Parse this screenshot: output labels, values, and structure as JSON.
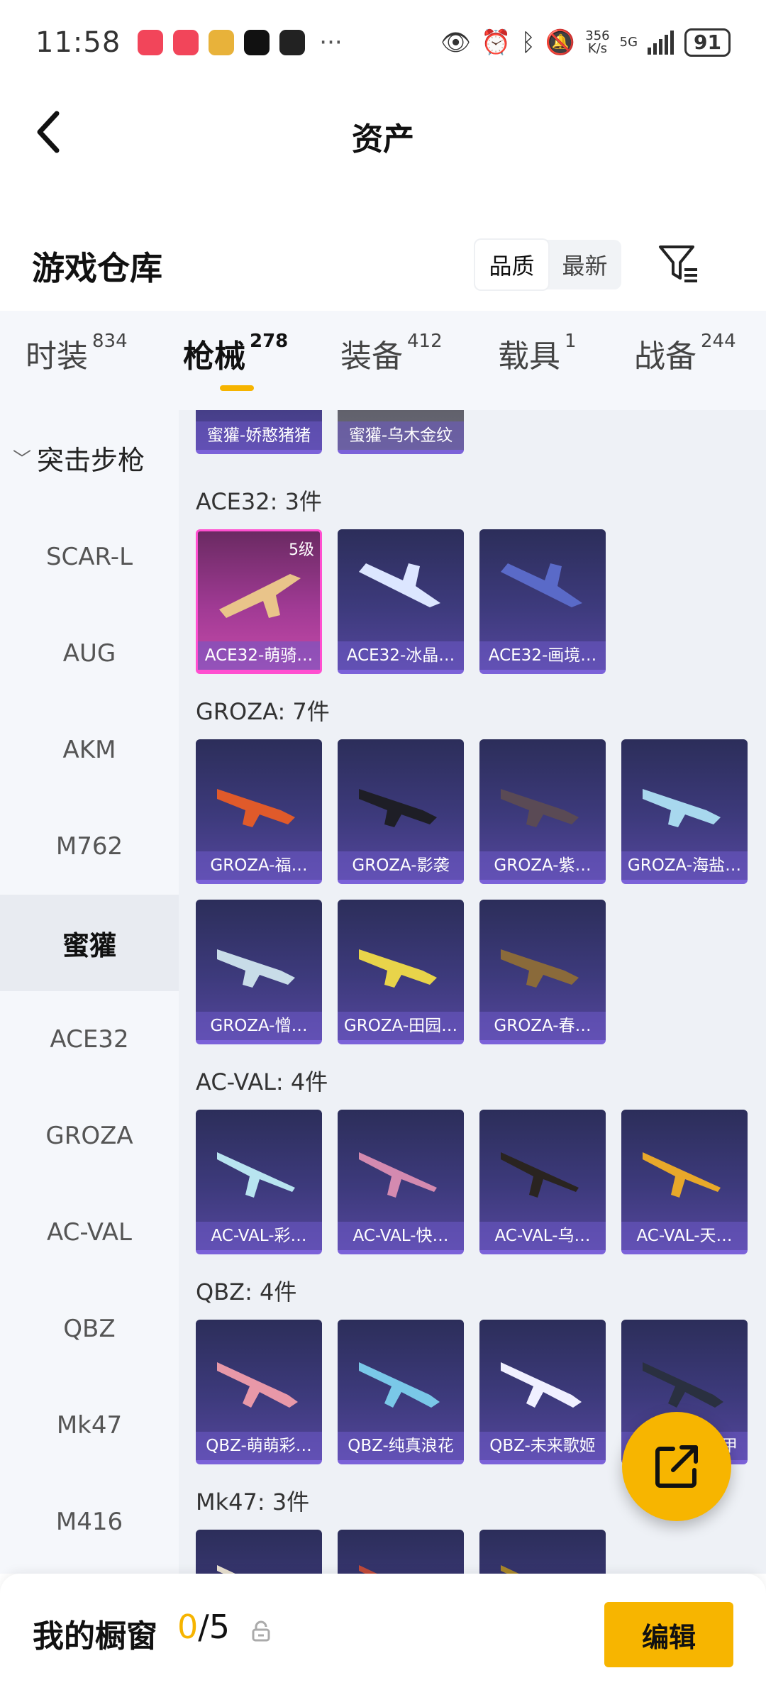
{
  "status_bar": {
    "time": "11:58",
    "more": "···",
    "net_speed_value": "356",
    "net_speed_unit": "K/s",
    "network": "5G",
    "battery": "91"
  },
  "header": {
    "title": "资产"
  },
  "warehouse": {
    "title": "游戏仓库",
    "sort_options": [
      "品质",
      "最新"
    ]
  },
  "tabs": [
    {
      "label": "时装",
      "count": "834"
    },
    {
      "label": "枪械",
      "count": "278"
    },
    {
      "label": "装备",
      "count": "412"
    },
    {
      "label": "载具",
      "count": "1"
    },
    {
      "label": "战备",
      "count": "244"
    }
  ],
  "sidebar": {
    "category": "突击步枪",
    "items": [
      "SCAR-L",
      "AUG",
      "AKM",
      "M762",
      "蜜獾",
      "ACE32",
      "GROZA",
      "AC-VAL",
      "QBZ",
      "Mk47",
      "M416"
    ]
  },
  "groups": {
    "mihuan_cards": [
      "蜜獾-娇憨猪猪",
      "蜜獾-乌木金纹"
    ],
    "ace32": {
      "label": "ACE32: 3件",
      "level": "5级",
      "cards": [
        "ACE32-萌骑…",
        "ACE32-冰晶…",
        "ACE32-画境…"
      ]
    },
    "groza": {
      "label": "GROZA: 7件",
      "cards": [
        "GROZA-福…",
        "GROZA-影袭",
        "GROZA-紫…",
        "GROZA-海盐…",
        "GROZA-憎…",
        "GROZA-田园…",
        "GROZA-春…"
      ]
    },
    "acval": {
      "label": "AC-VAL: 4件",
      "cards": [
        "AC-VAL-彩…",
        "AC-VAL-快…",
        "AC-VAL-乌…",
        "AC-VAL-天…"
      ]
    },
    "qbz": {
      "label": "QBZ: 4件",
      "cards": [
        "QBZ-萌萌彩…",
        "QBZ-纯真浪花",
        "QBZ-未来歌姬",
        "甲"
      ]
    },
    "mk47": {
      "label": "Mk47: 3件"
    }
  },
  "bottom": {
    "label": "我的橱窗",
    "used": "0",
    "total": "/5",
    "edit": "编辑"
  },
  "colors": {
    "accent": "#f7b500",
    "card_purple": "#3d3a7c",
    "card_pink": "#c54aa8"
  }
}
